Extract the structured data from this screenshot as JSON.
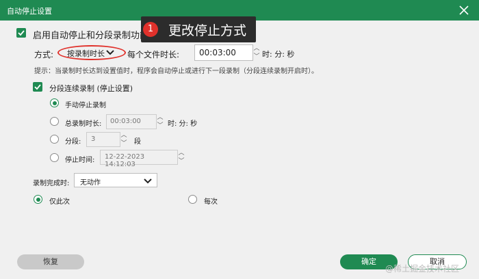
{
  "window": {
    "title": "自动停止设置"
  },
  "annotation": {
    "number": "1",
    "text": "更改停止方式"
  },
  "enable": {
    "label": "启用自动停止和分段录制功能",
    "checked": true
  },
  "mode": {
    "label": "方式:",
    "value": "按录制时长",
    "per_file_label": "每个文件时长:",
    "duration": "00:03:00",
    "units": "时: 分: 秒"
  },
  "hint": "提示：当录制时长达到设置值时，程序会自动停止或进行下一段录制（分段连续录制开启时）。",
  "segment": {
    "label": "分段连续录制  (停止设置)",
    "checked": true,
    "options": {
      "manual": "手动停止录制",
      "total_label": "总录制时长:",
      "total_value": "00:03:00",
      "total_units": "时: 分: 秒",
      "parts_label": "分段:",
      "parts_value": "3",
      "parts_unit": "段",
      "stop_time_label": "停止时间:",
      "stop_time_value": "12-22-2023 14:12:03"
    }
  },
  "complete": {
    "label": "录制完成时:",
    "value": "无动作"
  },
  "frequency": {
    "once": "仅此次",
    "every": "每次"
  },
  "buttons": {
    "restore": "恢复",
    "ok": "确定",
    "cancel": "取消"
  },
  "watermark": "@稀土掘金技术社区"
}
